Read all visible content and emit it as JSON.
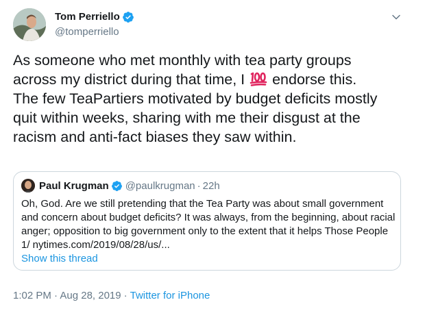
{
  "author": {
    "name": "Tom Perriello",
    "handle": "@tomperriello"
  },
  "tweet": {
    "text_part1": "As someone who met monthly with tea party groups\nacross my district during that time, I ",
    "emoji": "hundred-points",
    "text_part2": " endorse this.\nThe few TeaPartiers motivated by budget deficits mostly\nquit within weeks, sharing with me their disgust at the\nracism and anti-fact biases they saw within."
  },
  "quoted": {
    "name": "Paul Krugman",
    "handle": "@paulkrugman",
    "dot": "·",
    "time": "22h",
    "body": "Oh, God. Are we still pretending that the Tea Party was about small government and concern about budget deficits? It was always, from the beginning, about racial anger; opposition to big government only to the extent that it helps Those People 1/ nytimes.com/2019/08/28/us/...",
    "show_thread": "Show this thread"
  },
  "meta": {
    "timestamp": "1:02 PM · Aug 28, 2019",
    "sep": "·",
    "source": "Twitter for iPhone"
  },
  "icons": {
    "verified": "verified-badge-icon",
    "caret": "chevron-down-icon"
  },
  "colors": {
    "link": "#1b95e0",
    "verified": "#1da1f2",
    "secondary": "#657786",
    "border": "#ccd6dd"
  }
}
